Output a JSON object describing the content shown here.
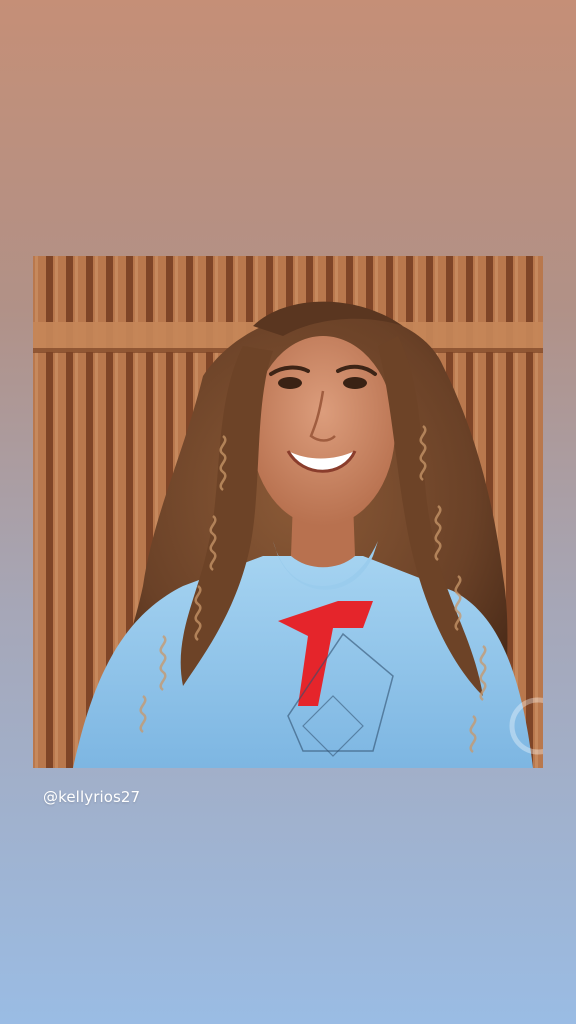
{
  "story": {
    "mention": "@kellyrios27",
    "photo": {
      "subject": "woman-portrait",
      "colors": {
        "background_top": "#c58f77",
        "background_bottom": "#9abce4",
        "wood": "#b5774e",
        "wood_dark": "#8a4f2c",
        "hoodie": "#8ec3e8",
        "hoodie_logo": "#e5252b",
        "skin": "#c78566",
        "hair": "#6e4529"
      }
    }
  }
}
